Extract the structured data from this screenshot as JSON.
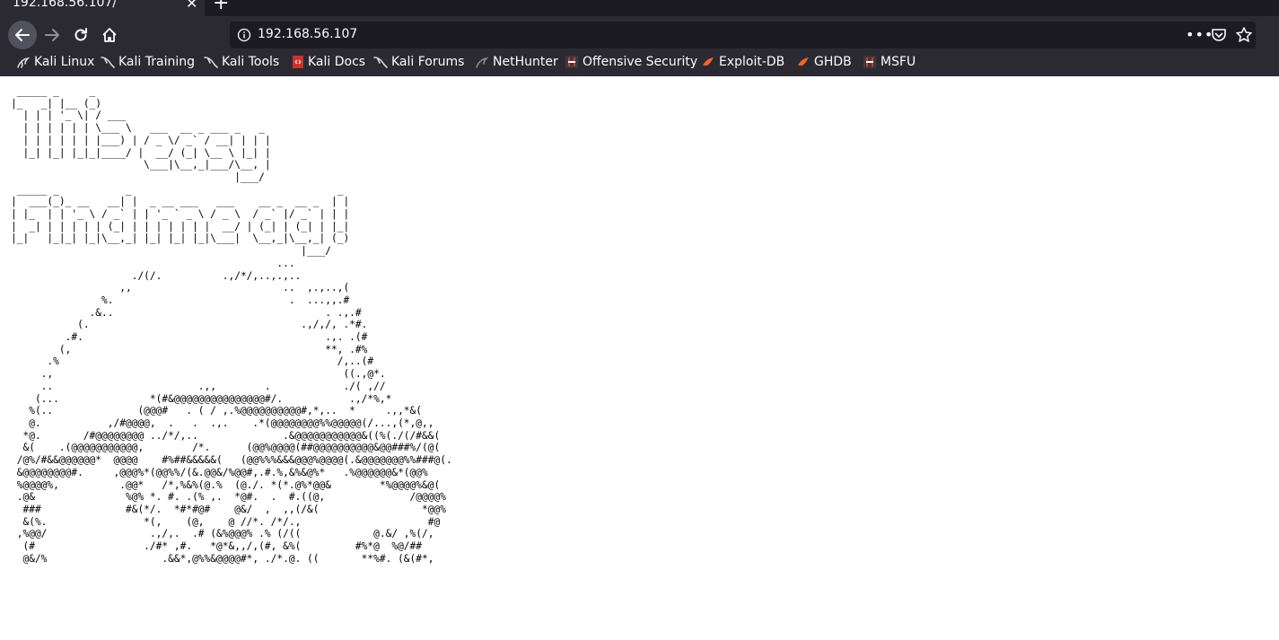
{
  "tab": {
    "title": "192.168.56.107/",
    "close_label": "✕",
    "new_tab_label": "+"
  },
  "url": {
    "text": "192.168.56.107",
    "meatball": "•••"
  },
  "icons": {
    "back": "arrow-left-icon",
    "forward": "arrow-right-icon",
    "reload": "reload-icon",
    "home": "home-icon",
    "info": "info-icon",
    "pocket": "pocket-icon",
    "star": "star-icon"
  },
  "bookmarks": [
    {
      "label": "Kali Linux",
      "icon": "kali-dragon-icon"
    },
    {
      "label": "Kali Training",
      "icon": "kali-dragon-icon"
    },
    {
      "label": "Kali Tools",
      "icon": "kali-dragon-icon"
    },
    {
      "label": "Kali Docs",
      "icon": "kali-docs-icon"
    },
    {
      "label": "Kali Forums",
      "icon": "kali-dragon-icon"
    },
    {
      "label": "NetHunter",
      "icon": "nethunter-icon"
    },
    {
      "label": "Offensive Security",
      "icon": "offsec-icon"
    },
    {
      "label": "Exploit-DB",
      "icon": "exploitdb-icon"
    },
    {
      "label": "GHDB",
      "icon": "exploitdb-icon"
    },
    {
      "label": "MSFU",
      "icon": "offsec-icon"
    }
  ],
  "colors": {
    "chrome": "#2b2a33",
    "tabstrip": "#1c1b22",
    "urlbar": "#1c1b22",
    "text": "#fbfbfe",
    "page_bg": "#ffffff"
  },
  "page": {
    "ascii_art": " _____ _     _\n|_   _| |__ (_)\n  | | | '_ \\| / ___\n  | | | | | | \\___ \\   ___  __ _ ___ _   _\n  | | | | | | |___) | / _ \\/ _` / __| | | |\n  |_| |_| |_|_|____/ |  __/ (_| \\__ \\ |_| |\n                      \\___|\\__,_|___/\\__, |\n                                     |___/\n _____ _           _                                  _\n|  ___(_)_ __   __| |  _ __ ___   ___    __ _  __ _  | |\n| |_  | | '_ \\ / _` | | '_ ` _ \\ / _ \\  / _` |/ _` | | |\n|  _| | | | | | (_| | | | | | | |  __/ | (_| | (_| | |_|\n|_|   |_|_| |_|\\__,_| |_| |_| |_|\\___|  \\__,_|\\__,_| (_)\n                                                |___/\n                                            ...\n                    ./(/.          .,/*/,..,.,..\n                  ,,                         ..  ,.,..,(\n               %.                             .  ...,,.#\n             .&..                                   . .,.#\n           (.                                   .,/,/, .*#.\n         .#.                                        .,. .(#\n        (,                                          **, .#%\n      .%                                              /,..(#\n     .,                                                ((.,@*.\n     ..                        .,,        .            ./( ,//\n    (...               *(#&@@@@@@@@@@@@@@@#/.           .,/*%,*\n   %(..              (@@@#   . ( / ,.%@@@@@@@@@@#,*,..  *     .,,*&(\n   @.           ,/#@@@@,  .   .  .,.    .*(@@@@@@@@%%@@@@@(/...,(*,@,,\n  *@.       /#@@@@@@@@ ../*/,..              .&@@@@@@@@@@@&((%(./(/#&&(\n  &(    .(@@@@@@@@@@@,        /*.      (@@%@@@@(##@@@@@@@@@@&@@###%/(@(\n /@%/#&&@@@@@@*  @@@@    #%##&&&&&(   (@@%%%&&&@@@%@@@@(.&@@@@@@@%%###@(.\n &@@@@@@@@#.     ,@@@%*(@@%%/(&.@@&/%@@#,.#.%,&%&@%*   .%@@@@@@&*(@@%\n %@@@@%,          .@@*   /*,%&%(@.%  (@./. *(*.@%*@@&        *%@@@@%&@(\n .@&               %@% *. #. .(% ,.  *@#.  .  #.((@,              /@@@@%\n  ###              #&(*/.  *#*#@#    @&/  ,  ,,(/&(                 *@@%\n  &(%.                *(,    (@,    @ //*. /*/.,                     #@\n ,%@@/                 .,/,.  .# (&%@@@% .% (/((            @.&/ ,%(/,\n  (#                  ./#* ,#.   *@*&,,/,(#, &%(         #%*@  %@/##\n  @&/%                   .&&*,@%%&@@@@#*, ./*.@. ((       **%#. (&(#*,"
  }
}
